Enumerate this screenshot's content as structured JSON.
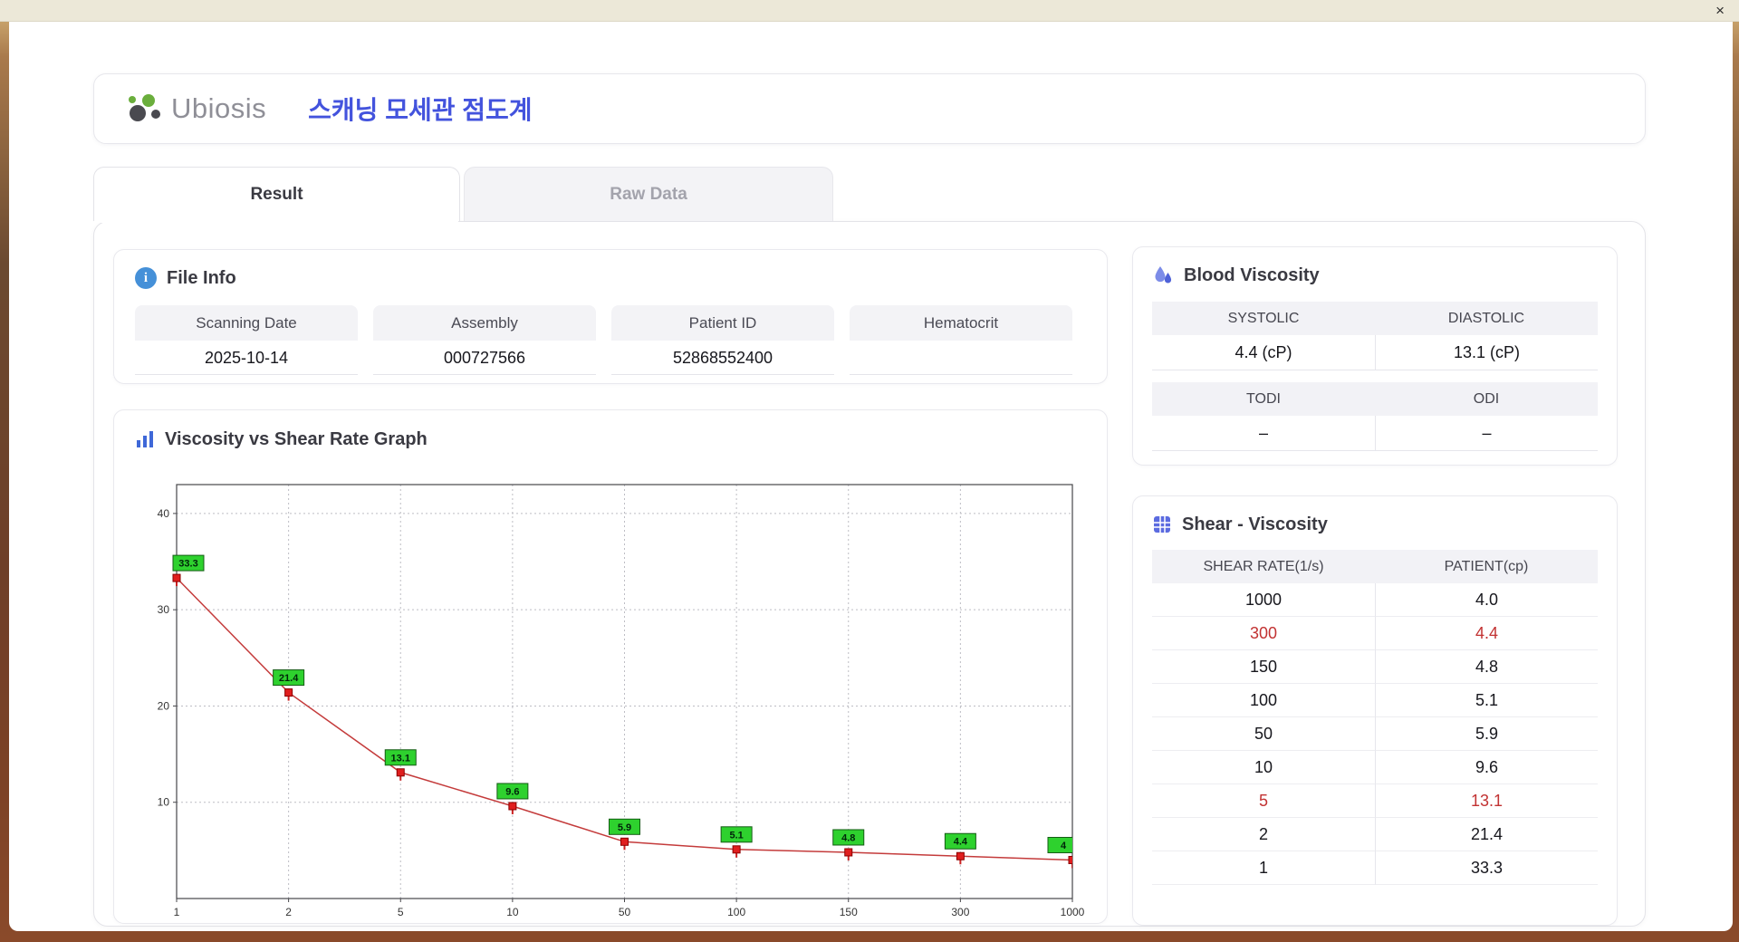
{
  "window": {
    "close_glyph": "×"
  },
  "header": {
    "logo_text": "Ubiosis",
    "title": "스캐닝 모세관 점도계"
  },
  "tabs": {
    "result": "Result",
    "raw_data": "Raw Data"
  },
  "file_info": {
    "title": "File Info",
    "fields": [
      {
        "label": "Scanning Date",
        "value": "2025-10-14"
      },
      {
        "label": "Assembly",
        "value": "000727566"
      },
      {
        "label": "Patient ID",
        "value": "52868552400"
      },
      {
        "label": "Hematocrit",
        "value": ""
      }
    ]
  },
  "blood_viscosity": {
    "title": "Blood Viscosity",
    "systolic_label": "SYSTOLIC",
    "systolic_value": "4.4 (cP)",
    "diastolic_label": "DIASTOLIC",
    "diastolic_value": "13.1 (cP)",
    "todi_label": "TODI",
    "todi_value": "–",
    "odi_label": "ODI",
    "odi_value": "–"
  },
  "shear_viscosity": {
    "title": "Shear - Viscosity",
    "columns": [
      "SHEAR RATE(1/s)",
      "PATIENT(cp)"
    ],
    "rows": [
      {
        "shear": "1000",
        "patient": "4.0",
        "highlight": false
      },
      {
        "shear": "300",
        "patient": "4.4",
        "highlight": true
      },
      {
        "shear": "150",
        "patient": "4.8",
        "highlight": false
      },
      {
        "shear": "100",
        "patient": "5.1",
        "highlight": false
      },
      {
        "shear": "50",
        "patient": "5.9",
        "highlight": false
      },
      {
        "shear": "10",
        "patient": "9.6",
        "highlight": false
      },
      {
        "shear": "5",
        "patient": "13.1",
        "highlight": true
      },
      {
        "shear": "2",
        "patient": "21.4",
        "highlight": false
      },
      {
        "shear": "1",
        "patient": "33.3",
        "highlight": false
      }
    ]
  },
  "chart_data": {
    "type": "line",
    "title": "Viscosity vs Shear Rate Graph",
    "x": [
      1,
      2,
      5,
      10,
      50,
      100,
      150,
      300,
      1000
    ],
    "x_tick_labels": [
      "1",
      "2",
      "5",
      "10",
      "50",
      "100",
      "150",
      "300",
      "1000"
    ],
    "values": [
      33.3,
      21.4,
      13.1,
      9.6,
      5.9,
      5.1,
      4.8,
      4.4,
      4.0
    ],
    "point_labels": [
      "33.3",
      "21.4",
      "13.1",
      "9.6",
      "5.9",
      "5.1",
      "4.8",
      "4.4",
      "4"
    ],
    "xlabel": "",
    "ylabel": "",
    "y_ticks": [
      10,
      20,
      30,
      40
    ],
    "ylim": [
      0,
      43
    ],
    "x_axis": "category",
    "grid": true,
    "legend": false,
    "line_color": "#c43b3b",
    "marker_color": "#e01e1e",
    "point_label_bg": "#2ed12e"
  },
  "colors": {
    "accent_blue": "#4353dd",
    "highlight_red": "#c23232",
    "label_green": "#2ed12e",
    "header_gray": "#f2f2f6"
  }
}
